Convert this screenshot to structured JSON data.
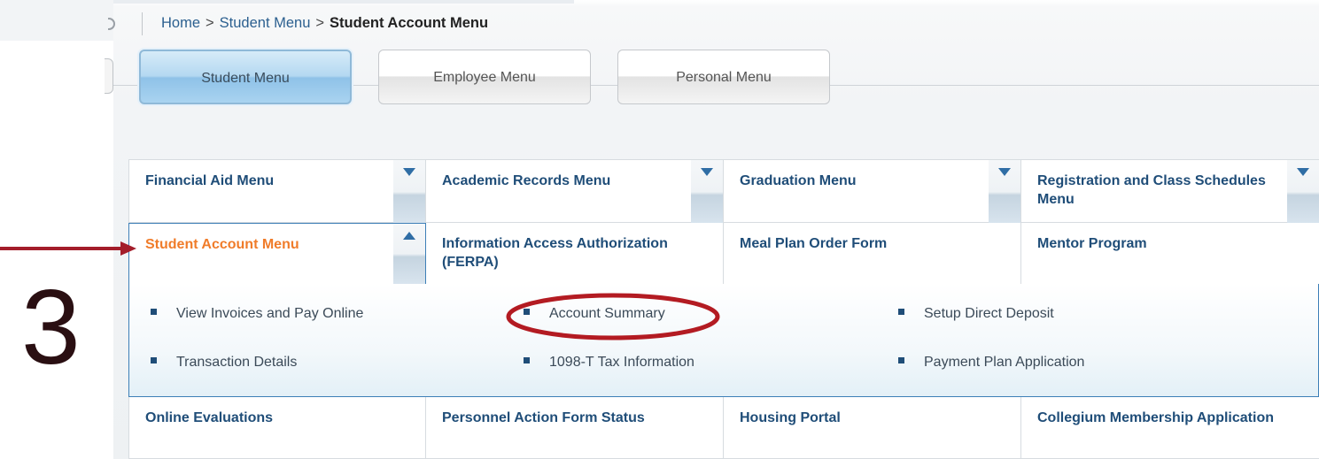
{
  "breadcrumb": {
    "home": "Home",
    "separator": ">",
    "student_menu": "Student Menu",
    "current": "Student Account Menu"
  },
  "tabs": [
    {
      "label": "Student Menu",
      "active": true
    },
    {
      "label": "Employee Menu",
      "active": false
    },
    {
      "label": "Personal Menu",
      "active": false
    }
  ],
  "menu": {
    "row1": [
      {
        "label": "Financial Aid Menu"
      },
      {
        "label": "Academic Records Menu"
      },
      {
        "label": "Graduation Menu"
      },
      {
        "label": "Registration and Class Schedules Menu"
      }
    ],
    "row2": [
      {
        "label": "Student Account Menu"
      },
      {
        "label": "Information Access Authorization (FERPA)"
      },
      {
        "label": "Meal Plan Order Form"
      },
      {
        "label": "Mentor Program"
      }
    ],
    "submenu": [
      {
        "label": "View Invoices and Pay Online"
      },
      {
        "label": "Account Summary"
      },
      {
        "label": "Setup Direct Deposit"
      },
      {
        "label": "Transaction Details"
      },
      {
        "label": "1098-T Tax Information"
      },
      {
        "label": "Payment Plan Application"
      }
    ],
    "row3": [
      {
        "label": "Online Evaluations"
      },
      {
        "label": "Personnel Action Form Status"
      },
      {
        "label": "Housing Portal"
      },
      {
        "label": "Collegium Membership Application"
      }
    ]
  },
  "annotation": {
    "step_number": "3",
    "arrow_color": "#a31d2a",
    "circle_color": "#b31b22"
  },
  "colors": {
    "link": "#1f4d78",
    "active_menu": "#f07c2a",
    "active_tab": "#a9d3f0",
    "submenu_border": "#3d7fb7"
  }
}
